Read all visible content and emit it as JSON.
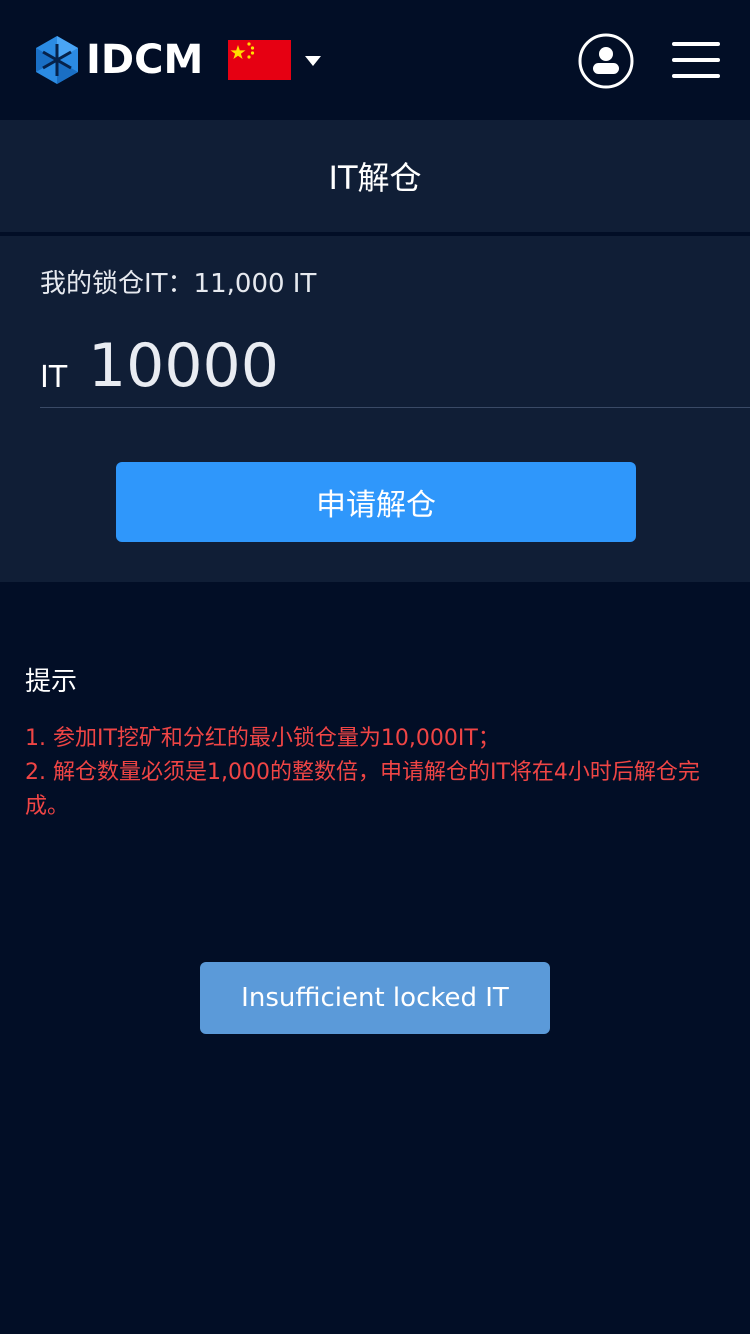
{
  "header": {
    "brand": "IDCM",
    "language_flag": "china-flag",
    "user_icon": "user-circle-icon",
    "menu_icon": "hamburger-menu-icon"
  },
  "title": "IT解仓",
  "form": {
    "locked_label": "我的锁仓IT：11,000 IT",
    "amount_unit": "IT",
    "amount_value": "10000",
    "apply_label": "申请解仓"
  },
  "tips": {
    "title": "提示",
    "items": [
      "1. 参加IT挖矿和分红的最小锁仓量为10,000IT；",
      "2. 解仓数量必须是1,000的整数倍，申请解仓的IT将在4小时后解仓完成。"
    ]
  },
  "toast": {
    "message": "Insufficient locked IT"
  },
  "colors": {
    "background": "#020e26",
    "panel": "#101e36",
    "primary_button": "#2f97fb",
    "tip_text": "#f04545",
    "toast": "#5b9ad9"
  }
}
